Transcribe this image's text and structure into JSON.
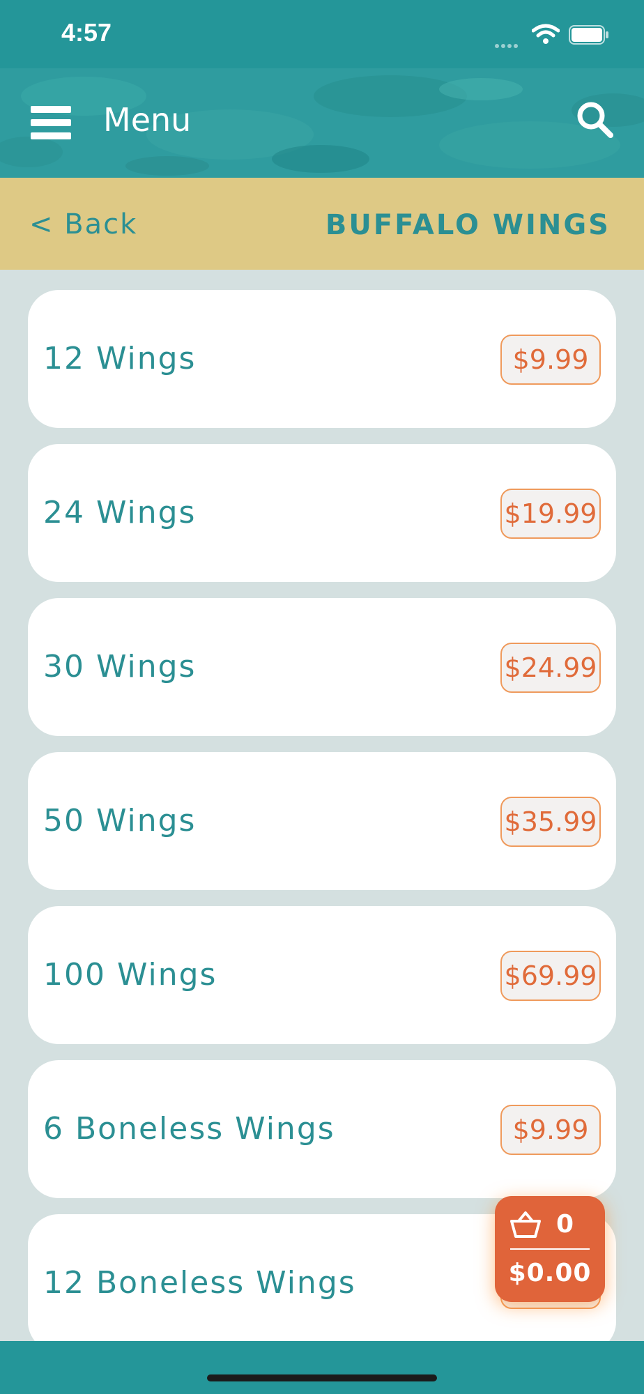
{
  "status_bar": {
    "time": "4:57"
  },
  "header": {
    "title": "Menu"
  },
  "subheader": {
    "back_label": "< Back",
    "section_title": "BUFFALO WINGS"
  },
  "items": [
    {
      "name": "12 Wings",
      "price": "$9.99"
    },
    {
      "name": "24 Wings",
      "price": "$19.99"
    },
    {
      "name": "30 Wings",
      "price": "$24.99"
    },
    {
      "name": "50 Wings",
      "price": "$35.99"
    },
    {
      "name": "100 Wings",
      "price": "$69.99"
    },
    {
      "name": "6 Boneless Wings",
      "price": "$9.99"
    },
    {
      "name": "12 Boneless Wings",
      "price": ""
    }
  ],
  "cart": {
    "count": "0",
    "total": "$0.00"
  },
  "colors": {
    "primary": "#249699",
    "accent": "#e0643a",
    "subheader_bg": "#dec985",
    "list_bg": "#d4e0e0"
  },
  "icons": {
    "menu": "hamburger-icon",
    "search": "search-icon",
    "cart": "basket-icon",
    "wifi": "wifi-icon",
    "battery": "battery-icon"
  }
}
